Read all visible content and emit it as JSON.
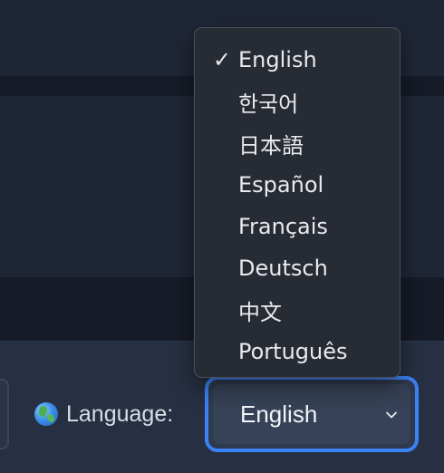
{
  "background_panels": [
    "top-band",
    "middle-band",
    "footer-bar"
  ],
  "footer": {
    "language_label": "Language:",
    "globe_icon": "globe-icon"
  },
  "language_select": {
    "selected_value": "English",
    "chevron_icon": "chevron-down-icon",
    "accent_color": "#3b82f6"
  },
  "dropdown": {
    "check_mark": "✓",
    "items": [
      {
        "label": "English",
        "selected": true
      },
      {
        "label": "한국어",
        "selected": false
      },
      {
        "label": "日本語",
        "selected": false
      },
      {
        "label": "Español",
        "selected": false
      },
      {
        "label": "Français",
        "selected": false
      },
      {
        "label": "Deutsch",
        "selected": false
      },
      {
        "label": "中文",
        "selected": false
      },
      {
        "label": "Português",
        "selected": false
      }
    ]
  }
}
